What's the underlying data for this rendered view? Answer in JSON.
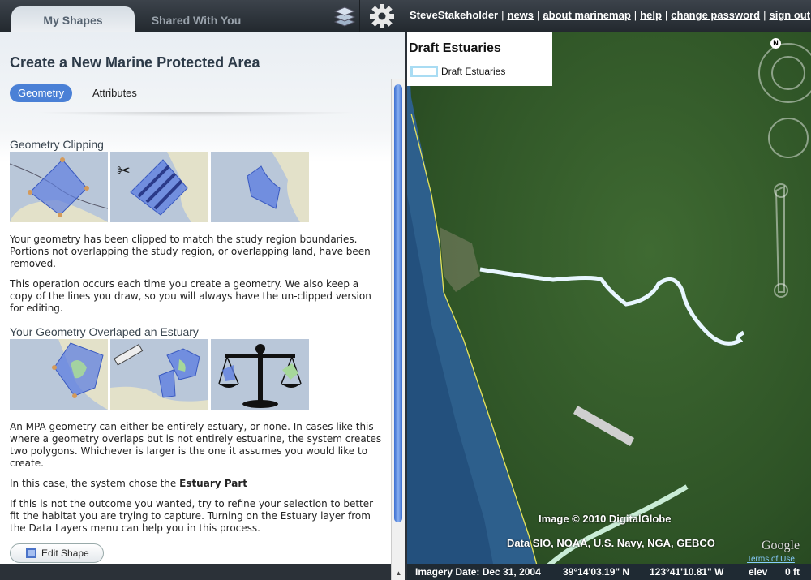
{
  "topbar": {
    "tabs": [
      {
        "label": "My Shapes"
      },
      {
        "label": "Shared With You"
      }
    ],
    "user": "SteveStakeholder",
    "links": [
      "news",
      "about marinemap",
      "help",
      "change password",
      "sign out"
    ],
    "layers_icon": "layers-icon",
    "gear_icon": "gear-icon"
  },
  "panel": {
    "title": "Create a New Marine Protected Area",
    "subtabs": [
      "Geometry",
      "Attributes"
    ],
    "section1": {
      "heading": "Geometry Clipping",
      "p1": "Your geometry has been clipped to match the study region boundaries. Portions not overlapping the study region, or overlapping land, have been removed.",
      "p2": "This operation occurs each time you create a geometry. We also keep a copy of the lines you draw, so you will always have the un-clipped version for editing."
    },
    "section2": {
      "heading": "Your Geometry Overlaped an Estuary",
      "p1": "An MPA geometry can either be entirely estuary, or none. In cases like this where a geometry overlaps but is not entirely estuarine, the system creates two polygons. Whichever is larger is the one it assumes you would like to create.",
      "p2_prefix": "In this case, the system chose the",
      "p2_bold": "Estuary Part",
      "p3": "If this is not the outcome you wanted, try to refine your selection to better fit the habitat you are trying to capture. Turning on the Estuary layer from the Data Layers menu can help you in this process."
    },
    "edit_button": "Edit Shape"
  },
  "map": {
    "legend_title": "Draft Estuaries",
    "legend_label": "Draft Estuaries",
    "legend_color": "#a9dcf3",
    "credit1": "Image © 2010 DigitalGlobe",
    "credit2": "Data SIO, NOAA, U.S. Navy, NGA, GEBCO",
    "google": "Google",
    "terms": "Terms of Use",
    "compass_n": "N",
    "status": {
      "imagery": "Imagery Date: Dec 31, 2004",
      "lat": "39°14'03.19\" N",
      "lon": "123°41'10.81\" W",
      "elev": "elev",
      "elev_val": "0 ft"
    }
  }
}
